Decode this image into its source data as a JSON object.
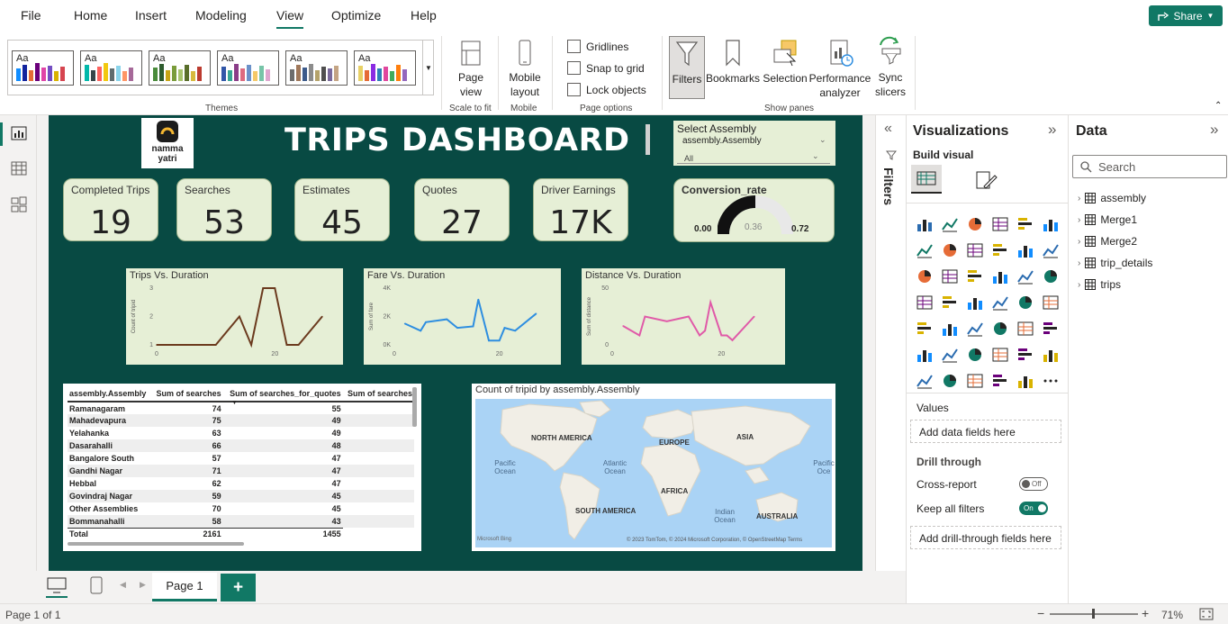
{
  "menu": {
    "items": [
      "File",
      "Home",
      "Insert",
      "Modeling",
      "View",
      "Optimize",
      "Help"
    ],
    "active": "View",
    "share_label": "Share"
  },
  "ribbon": {
    "themes_label": "Themes",
    "theme_sample_text": "Aa",
    "page_view_label": "Page view",
    "scale_to_fit_label": "Scale to fit",
    "mobile_layout_label": "Mobile layout",
    "mobile_group_label": "Mobile",
    "gridlines_label": "Gridlines",
    "snap_to_grid_label": "Snap to grid",
    "lock_objects_label": "Lock objects",
    "page_options_label": "Page options",
    "filters_label": "Filters",
    "bookmarks_label": "Bookmarks",
    "selection_label": "Selection",
    "performance_label": "Performance analyzer",
    "sync_label": "Sync slicers",
    "show_panes_label": "Show panes"
  },
  "dashboard": {
    "logo_line1": "namma",
    "logo_line2": "yatri",
    "title": "TRIPS DASHBOARD",
    "slicer_title": "Select Assembly",
    "slicer_field": "assembly.Assembly",
    "slicer_value": "All",
    "kpis": [
      {
        "label": "Completed Trips",
        "value": "19"
      },
      {
        "label": "Searches",
        "value": "53"
      },
      {
        "label": "Estimates",
        "value": "45"
      },
      {
        "label": "Quotes",
        "value": "27"
      },
      {
        "label": "Driver Earnings",
        "value": "17K"
      }
    ],
    "gauge": {
      "label": "Conversion_rate",
      "min": "0.00",
      "value": "0.36",
      "max": "0.72",
      "fraction": 0.5
    }
  },
  "chart_data": [
    {
      "type": "line",
      "title": "Trips Vs. Duration",
      "ylabel": "Count of tripid",
      "x_ticks": [
        "0",
        "20"
      ],
      "y_ticks": [
        "1",
        "2",
        "3"
      ],
      "color": "#6b3a1e",
      "x": [
        0,
        5,
        10,
        14,
        16,
        18,
        20,
        22,
        24,
        28
      ],
      "y": [
        1,
        1,
        1,
        2,
        1,
        3,
        3,
        1,
        1,
        2
      ],
      "xlim": [
        0,
        30
      ],
      "ylim": [
        1,
        3
      ]
    },
    {
      "type": "line",
      "title": "Fare Vs. Duration",
      "ylabel": "Sum of fare",
      "x_ticks": [
        "0",
        "20"
      ],
      "y_ticks": [
        "0K",
        "2K",
        "4K"
      ],
      "color": "#2e8ee0",
      "x": [
        2,
        5,
        6,
        10,
        12,
        15,
        16,
        18,
        20,
        21,
        23,
        27
      ],
      "y": [
        1500,
        1000,
        1600,
        1800,
        1200,
        1300,
        3200,
        300,
        300,
        1200,
        1000,
        2200
      ],
      "xlim": [
        0,
        30
      ],
      "ylim": [
        0,
        4000
      ]
    },
    {
      "type": "line",
      "title": "Distance Vs. Duration",
      "ylabel": "Sum of distance",
      "x_ticks": [
        "0",
        "20"
      ],
      "y_ticks": [
        "0",
        "50"
      ],
      "color": "#e05aa8",
      "x": [
        2,
        5,
        6,
        10,
        14,
        16,
        17,
        18,
        20,
        21,
        22,
        26
      ],
      "y": [
        20,
        10,
        30,
        25,
        30,
        10,
        15,
        45,
        10,
        10,
        5,
        30
      ],
      "xlim": [
        0,
        30
      ],
      "ylim": [
        0,
        60
      ]
    }
  ],
  "table": {
    "columns": [
      "assembly.Assembly",
      "Sum of searches",
      "Sum of searches_for_quotes",
      "Sum of searches"
    ],
    "rows": [
      [
        "Ramanagaram",
        "74",
        "55"
      ],
      [
        "Mahadevapura",
        "75",
        "49"
      ],
      [
        "Yelahanka",
        "63",
        "49"
      ],
      [
        "Dasarahalli",
        "66",
        "48"
      ],
      [
        "Bangalore South",
        "57",
        "47"
      ],
      [
        "Gandhi Nagar",
        "71",
        "47"
      ],
      [
        "Hebbal",
        "62",
        "47"
      ],
      [
        "Govindraj Nagar",
        "59",
        "45"
      ],
      [
        "Other Assemblies",
        "70",
        "45"
      ],
      [
        "Bommanahalli",
        "58",
        "43"
      ]
    ],
    "total": [
      "Total",
      "2161",
      "1455"
    ]
  },
  "map": {
    "title": "Count of tripid by assembly.Assembly",
    "labels": [
      "NORTH AMERICA",
      "EUROPE",
      "ASIA",
      "AFRICA",
      "SOUTH AMERICA",
      "AUSTRALIA",
      "Pacific Ocean",
      "Atlantic Ocean",
      "Indian Ocean",
      "Pacific Oce"
    ],
    "credit": "Microsoft Bing",
    "copyright": "© 2023 TomTom, © 2024 Microsoft Corporation, © OpenStreetMap  Terms"
  },
  "filters_pane_label": "Filters",
  "viz": {
    "title": "Visualizations",
    "build_visual": "Build visual",
    "values_label": "Values",
    "values_placeholder": "Add data fields here",
    "drill_through": "Drill through",
    "cross_report": "Cross-report",
    "cross_report_state": "Off",
    "keep_filters": "Keep all filters",
    "keep_filters_state": "On",
    "drill_placeholder": "Add drill-through fields here"
  },
  "data_pane": {
    "title": "Data",
    "search_placeholder": "Search",
    "tables": [
      "assembly",
      "Merge1",
      "Merge2",
      "trip_details",
      "trips"
    ]
  },
  "pages": {
    "tabs": [
      "Page 1"
    ],
    "add_label": "+"
  },
  "status": {
    "page_info": "Page 1 of 1",
    "zoom": "71%"
  }
}
